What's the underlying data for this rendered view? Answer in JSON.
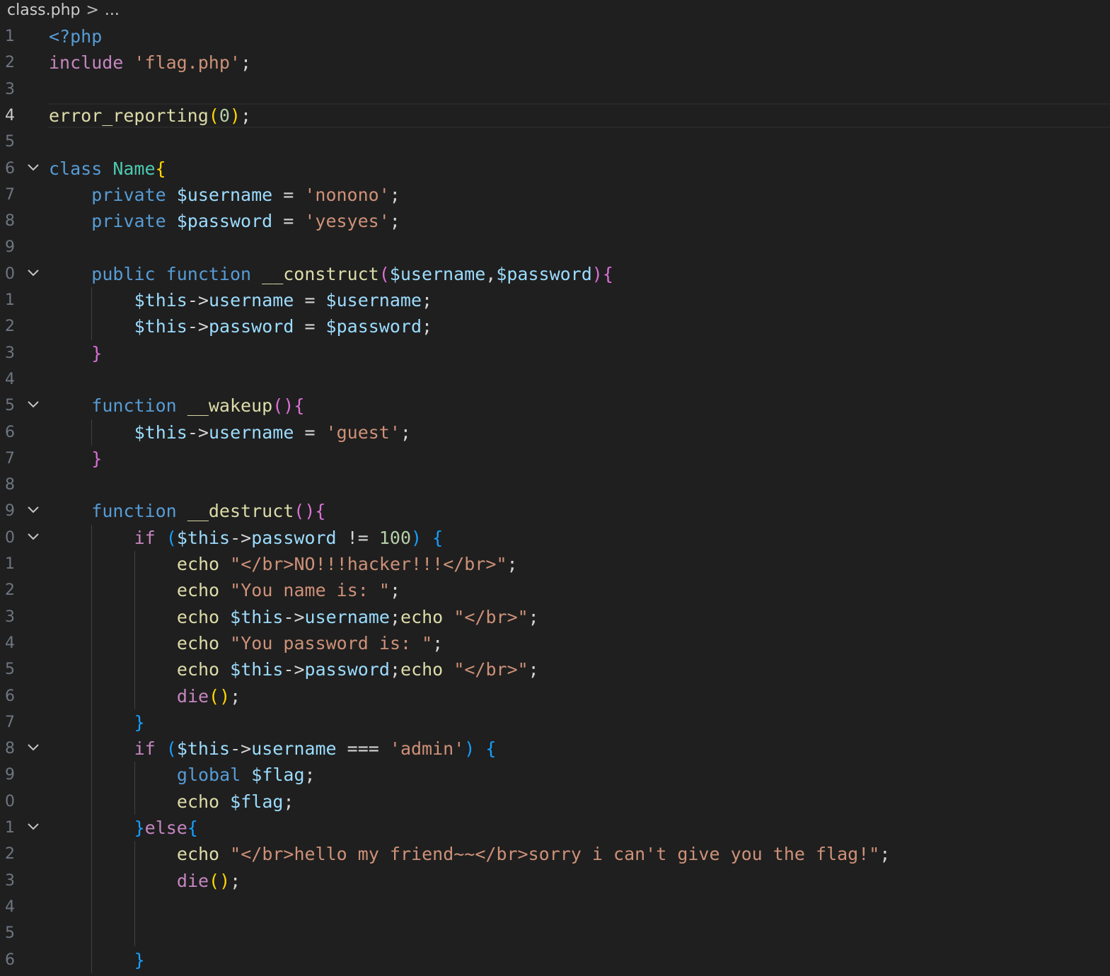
{
  "breadcrumb": {
    "file": "class.php",
    "separator": ">",
    "more": "..."
  },
  "editor": {
    "language": "php",
    "current_line": 4,
    "lines": [
      {
        "num": "1",
        "fold": false,
        "indent": 0,
        "tokens": [
          {
            "t": "kw",
            "v": "<?php"
          }
        ]
      },
      {
        "num": "2",
        "fold": false,
        "indent": 0,
        "tokens": [
          {
            "t": "ctl",
            "v": "include"
          },
          {
            "t": "pl",
            "v": " "
          },
          {
            "t": "str",
            "v": "'flag.php'"
          },
          {
            "t": "pl",
            "v": ";"
          }
        ]
      },
      {
        "num": "3",
        "fold": false,
        "indent": 0,
        "tokens": []
      },
      {
        "num": "4",
        "fold": false,
        "indent": 0,
        "tokens": [
          {
            "t": "fn",
            "v": "error_reporting"
          },
          {
            "t": "b1",
            "v": "("
          },
          {
            "t": "num",
            "v": "0"
          },
          {
            "t": "b1",
            "v": ")"
          },
          {
            "t": "pl",
            "v": ";"
          }
        ]
      },
      {
        "num": "5",
        "fold": false,
        "indent": 0,
        "tokens": []
      },
      {
        "num": "6",
        "fold": true,
        "indent": 0,
        "tokens": [
          {
            "t": "kw",
            "v": "class"
          },
          {
            "t": "pl",
            "v": " "
          },
          {
            "t": "cls",
            "v": "Name"
          },
          {
            "t": "b1",
            "v": "{"
          }
        ]
      },
      {
        "num": "7",
        "fold": false,
        "indent": 1,
        "tokens": [
          {
            "t": "kw",
            "v": "private"
          },
          {
            "t": "pl",
            "v": " "
          },
          {
            "t": "var",
            "v": "$username"
          },
          {
            "t": "pl",
            "v": " = "
          },
          {
            "t": "str",
            "v": "'nonono'"
          },
          {
            "t": "pl",
            "v": ";"
          }
        ]
      },
      {
        "num": "8",
        "fold": false,
        "indent": 1,
        "tokens": [
          {
            "t": "kw",
            "v": "private"
          },
          {
            "t": "pl",
            "v": " "
          },
          {
            "t": "var",
            "v": "$password"
          },
          {
            "t": "pl",
            "v": " = "
          },
          {
            "t": "str",
            "v": "'yesyes'"
          },
          {
            "t": "pl",
            "v": ";"
          }
        ]
      },
      {
        "num": "9",
        "fold": false,
        "indent": 1,
        "tokens": []
      },
      {
        "num": "0",
        "fold": true,
        "indent": 1,
        "tokens": [
          {
            "t": "kw",
            "v": "public"
          },
          {
            "t": "pl",
            "v": " "
          },
          {
            "t": "kw",
            "v": "function"
          },
          {
            "t": "pl",
            "v": " "
          },
          {
            "t": "fn",
            "v": "__construct"
          },
          {
            "t": "b2",
            "v": "("
          },
          {
            "t": "var",
            "v": "$username"
          },
          {
            "t": "pl",
            "v": ","
          },
          {
            "t": "var",
            "v": "$password"
          },
          {
            "t": "b2",
            "v": ")"
          },
          {
            "t": "b2",
            "v": "{"
          }
        ]
      },
      {
        "num": "1",
        "fold": false,
        "indent": 2,
        "tokens": [
          {
            "t": "var",
            "v": "$this"
          },
          {
            "t": "pl",
            "v": "->"
          },
          {
            "t": "var",
            "v": "username"
          },
          {
            "t": "pl",
            "v": " = "
          },
          {
            "t": "var",
            "v": "$username"
          },
          {
            "t": "pl",
            "v": ";"
          }
        ]
      },
      {
        "num": "2",
        "fold": false,
        "indent": 2,
        "tokens": [
          {
            "t": "var",
            "v": "$this"
          },
          {
            "t": "pl",
            "v": "->"
          },
          {
            "t": "var",
            "v": "password"
          },
          {
            "t": "pl",
            "v": " = "
          },
          {
            "t": "var",
            "v": "$password"
          },
          {
            "t": "pl",
            "v": ";"
          }
        ]
      },
      {
        "num": "3",
        "fold": false,
        "indent": 1,
        "tokens": [
          {
            "t": "b2",
            "v": "}"
          }
        ]
      },
      {
        "num": "4",
        "fold": false,
        "indent": 1,
        "tokens": []
      },
      {
        "num": "5",
        "fold": true,
        "indent": 1,
        "tokens": [
          {
            "t": "kw",
            "v": "function"
          },
          {
            "t": "pl",
            "v": " "
          },
          {
            "t": "fn",
            "v": "__wakeup"
          },
          {
            "t": "b2",
            "v": "("
          },
          {
            "t": "b2",
            "v": ")"
          },
          {
            "t": "b2",
            "v": "{"
          }
        ]
      },
      {
        "num": "6",
        "fold": false,
        "indent": 2,
        "tokens": [
          {
            "t": "var",
            "v": "$this"
          },
          {
            "t": "pl",
            "v": "->"
          },
          {
            "t": "var",
            "v": "username"
          },
          {
            "t": "pl",
            "v": " = "
          },
          {
            "t": "str",
            "v": "'guest'"
          },
          {
            "t": "pl",
            "v": ";"
          }
        ]
      },
      {
        "num": "7",
        "fold": false,
        "indent": 1,
        "tokens": [
          {
            "t": "b2",
            "v": "}"
          }
        ]
      },
      {
        "num": "8",
        "fold": false,
        "indent": 1,
        "tokens": []
      },
      {
        "num": "9",
        "fold": true,
        "indent": 1,
        "tokens": [
          {
            "t": "kw",
            "v": "function"
          },
          {
            "t": "pl",
            "v": " "
          },
          {
            "t": "fn",
            "v": "__destruct"
          },
          {
            "t": "b2",
            "v": "("
          },
          {
            "t": "b2",
            "v": ")"
          },
          {
            "t": "b2",
            "v": "{"
          }
        ]
      },
      {
        "num": "0",
        "fold": true,
        "indent": 2,
        "tokens": [
          {
            "t": "ctl",
            "v": "if"
          },
          {
            "t": "pl",
            "v": " "
          },
          {
            "t": "b3",
            "v": "("
          },
          {
            "t": "var",
            "v": "$this"
          },
          {
            "t": "pl",
            "v": "->"
          },
          {
            "t": "var",
            "v": "password"
          },
          {
            "t": "pl",
            "v": " != "
          },
          {
            "t": "num",
            "v": "100"
          },
          {
            "t": "b3",
            "v": ")"
          },
          {
            "t": "pl",
            "v": " "
          },
          {
            "t": "b3",
            "v": "{"
          }
        ]
      },
      {
        "num": "1",
        "fold": false,
        "indent": 3,
        "tokens": [
          {
            "t": "fn",
            "v": "echo"
          },
          {
            "t": "pl",
            "v": " "
          },
          {
            "t": "str",
            "v": "\"</br>NO!!!hacker!!!</br>\""
          },
          {
            "t": "pl",
            "v": ";"
          }
        ]
      },
      {
        "num": "2",
        "fold": false,
        "indent": 3,
        "tokens": [
          {
            "t": "fn",
            "v": "echo"
          },
          {
            "t": "pl",
            "v": " "
          },
          {
            "t": "str",
            "v": "\"You name is: \""
          },
          {
            "t": "pl",
            "v": ";"
          }
        ]
      },
      {
        "num": "3",
        "fold": false,
        "indent": 3,
        "tokens": [
          {
            "t": "fn",
            "v": "echo"
          },
          {
            "t": "pl",
            "v": " "
          },
          {
            "t": "var",
            "v": "$this"
          },
          {
            "t": "pl",
            "v": "->"
          },
          {
            "t": "var",
            "v": "username"
          },
          {
            "t": "pl",
            "v": ";"
          },
          {
            "t": "fn",
            "v": "echo"
          },
          {
            "t": "pl",
            "v": " "
          },
          {
            "t": "str",
            "v": "\"</br>\""
          },
          {
            "t": "pl",
            "v": ";"
          }
        ]
      },
      {
        "num": "4",
        "fold": false,
        "indent": 3,
        "tokens": [
          {
            "t": "fn",
            "v": "echo"
          },
          {
            "t": "pl",
            "v": " "
          },
          {
            "t": "str",
            "v": "\"You password is: \""
          },
          {
            "t": "pl",
            "v": ";"
          }
        ]
      },
      {
        "num": "5",
        "fold": false,
        "indent": 3,
        "tokens": [
          {
            "t": "fn",
            "v": "echo"
          },
          {
            "t": "pl",
            "v": " "
          },
          {
            "t": "var",
            "v": "$this"
          },
          {
            "t": "pl",
            "v": "->"
          },
          {
            "t": "var",
            "v": "password"
          },
          {
            "t": "pl",
            "v": ";"
          },
          {
            "t": "fn",
            "v": "echo"
          },
          {
            "t": "pl",
            "v": " "
          },
          {
            "t": "str",
            "v": "\"</br>\""
          },
          {
            "t": "pl",
            "v": ";"
          }
        ]
      },
      {
        "num": "6",
        "fold": false,
        "indent": 3,
        "tokens": [
          {
            "t": "ctl",
            "v": "die"
          },
          {
            "t": "b1",
            "v": "("
          },
          {
            "t": "b1",
            "v": ")"
          },
          {
            "t": "pl",
            "v": ";"
          }
        ]
      },
      {
        "num": "7",
        "fold": false,
        "indent": 2,
        "tokens": [
          {
            "t": "b3",
            "v": "}"
          }
        ]
      },
      {
        "num": "8",
        "fold": true,
        "indent": 2,
        "tokens": [
          {
            "t": "ctl",
            "v": "if"
          },
          {
            "t": "pl",
            "v": " "
          },
          {
            "t": "b3",
            "v": "("
          },
          {
            "t": "var",
            "v": "$this"
          },
          {
            "t": "pl",
            "v": "->"
          },
          {
            "t": "var",
            "v": "username"
          },
          {
            "t": "pl",
            "v": " === "
          },
          {
            "t": "str",
            "v": "'admin'"
          },
          {
            "t": "b3",
            "v": ")"
          },
          {
            "t": "pl",
            "v": " "
          },
          {
            "t": "b3",
            "v": "{"
          }
        ]
      },
      {
        "num": "9",
        "fold": false,
        "indent": 3,
        "tokens": [
          {
            "t": "kw",
            "v": "global"
          },
          {
            "t": "pl",
            "v": " "
          },
          {
            "t": "var",
            "v": "$flag"
          },
          {
            "t": "pl",
            "v": ";"
          }
        ]
      },
      {
        "num": "0",
        "fold": false,
        "indent": 3,
        "tokens": [
          {
            "t": "fn",
            "v": "echo"
          },
          {
            "t": "pl",
            "v": " "
          },
          {
            "t": "var",
            "v": "$flag"
          },
          {
            "t": "pl",
            "v": ";"
          }
        ]
      },
      {
        "num": "1",
        "fold": true,
        "indent": 2,
        "tokens": [
          {
            "t": "b3",
            "v": "}"
          },
          {
            "t": "ctl",
            "v": "else"
          },
          {
            "t": "b3",
            "v": "{"
          }
        ]
      },
      {
        "num": "2",
        "fold": false,
        "indent": 3,
        "tokens": [
          {
            "t": "fn",
            "v": "echo"
          },
          {
            "t": "pl",
            "v": " "
          },
          {
            "t": "str",
            "v": "\"</br>hello my friend~~</br>sorry i can't give you the flag!\""
          },
          {
            "t": "pl",
            "v": ";"
          }
        ]
      },
      {
        "num": "3",
        "fold": false,
        "indent": 3,
        "tokens": [
          {
            "t": "ctl",
            "v": "die"
          },
          {
            "t": "b1",
            "v": "("
          },
          {
            "t": "b1",
            "v": ")"
          },
          {
            "t": "pl",
            "v": ";"
          }
        ]
      },
      {
        "num": "4",
        "fold": false,
        "indent": 3,
        "tokens": []
      },
      {
        "num": "5",
        "fold": false,
        "indent": 3,
        "tokens": []
      },
      {
        "num": "6",
        "fold": false,
        "indent": 2,
        "tokens": [
          {
            "t": "b3",
            "v": "}"
          }
        ]
      }
    ]
  }
}
